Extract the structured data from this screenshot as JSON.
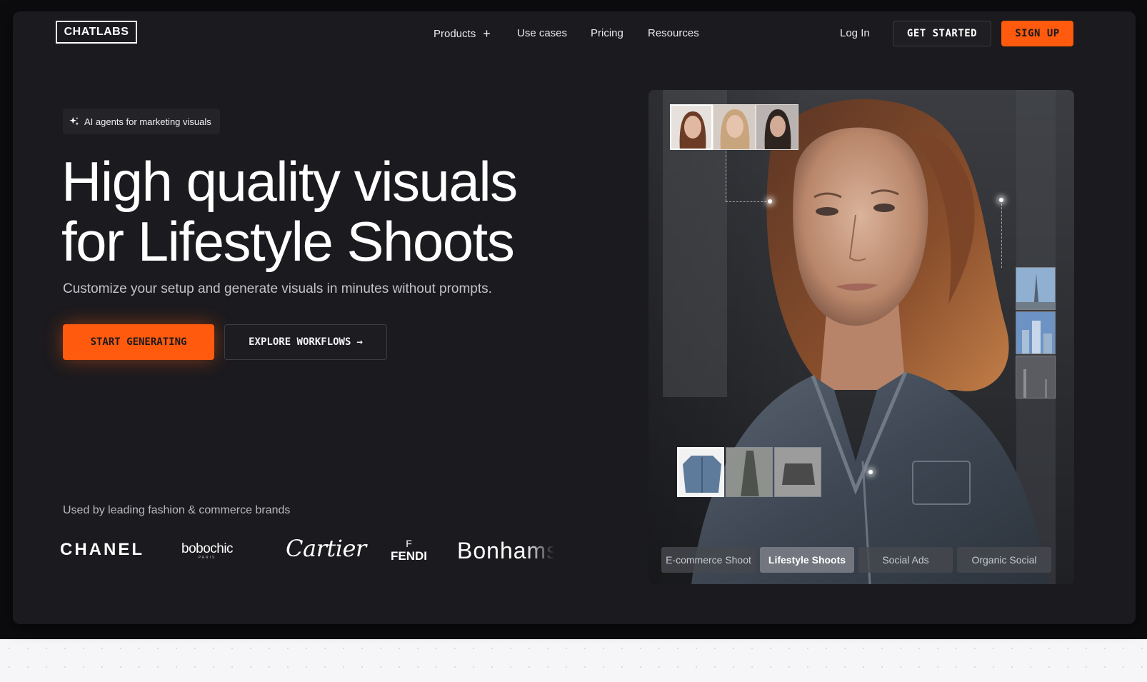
{
  "header": {
    "logo": "CHATLABS",
    "nav": [
      {
        "label": "Products",
        "has_plus": true
      },
      {
        "label": "Use cases"
      },
      {
        "label": "Pricing"
      },
      {
        "label": "Resources"
      }
    ],
    "plus_symbol": "+",
    "login": "Log In",
    "get_started": "GET STARTED",
    "sign_up": "SIGN UP"
  },
  "hero": {
    "badge": "AI agents for marketing visuals",
    "badge_icon": "sparkle-icon",
    "headline_line1": "High quality visuals",
    "headline_line2": "for Lifestyle Shoots",
    "subtitle": "Customize your setup and generate visuals in minutes without prompts.",
    "cta_primary": "START GENERATING",
    "cta_secondary": "EXPLORE WORKFLOWS",
    "cta_secondary_arrow": "→"
  },
  "brands": {
    "label": "Used by leading fashion & commerce brands",
    "items": {
      "chanel": "CHANEL",
      "bobochic": "bobochic",
      "bobochic_sub": "PARIS",
      "cartier": "Cartier",
      "fendi_top": "F",
      "fendi": "FENDI",
      "bonhams": "Bonhams"
    }
  },
  "panel": {
    "tabs": [
      "E-commerce Shoot",
      "Lifestyle Shoots",
      "Social Ads",
      "Organic Social"
    ],
    "active_tab": "Lifestyle Shoots"
  },
  "colors": {
    "accent": "#ff5a0d",
    "frame_bg": "#1b1a1e",
    "backdrop": "#0c0c0f"
  }
}
